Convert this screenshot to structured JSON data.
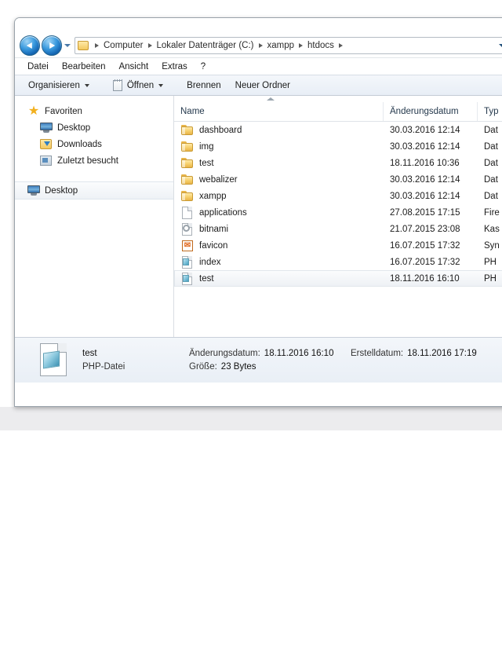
{
  "window": {
    "title": ""
  },
  "address_bar": {
    "back_label": "Zurück",
    "forward_label": "Vorwärts",
    "dropdown_label": "Letzte Seiten",
    "breadcrumbs": [
      "Computer",
      "Lokaler Datenträger (C:)",
      "xampp",
      "htdocs"
    ]
  },
  "menu": {
    "items": [
      "Datei",
      "Bearbeiten",
      "Ansicht",
      "Extras",
      "?"
    ]
  },
  "toolbar": {
    "organize_label": "Organisieren",
    "open_label": "Öffnen",
    "burn_label": "Brennen",
    "new_folder_label": "Neuer Ordner"
  },
  "sidebar": {
    "favorites_label": "Favoriten",
    "favorites": [
      {
        "label": "Desktop",
        "icon": "monitor-icon"
      },
      {
        "label": "Downloads",
        "icon": "downloads-icon"
      },
      {
        "label": "Zuletzt besucht",
        "icon": "recent-icon"
      }
    ],
    "desktop_root": {
      "label": "Desktop",
      "icon": "monitor-icon",
      "selected": true
    }
  },
  "file_list": {
    "columns": [
      "Name",
      "Änderungsdatum",
      "Typ"
    ],
    "sort_column": "Name",
    "sort_direction": "ascending",
    "rows": [
      {
        "name": "dashboard",
        "date": "30.03.2016 12:14",
        "type": "Dat",
        "icon": "folder-icon",
        "selected": false
      },
      {
        "name": "img",
        "date": "30.03.2016 12:14",
        "type": "Dat",
        "icon": "folder-icon",
        "selected": false
      },
      {
        "name": "test",
        "date": "18.11.2016 10:36",
        "type": "Dat",
        "icon": "folder-icon",
        "selected": false
      },
      {
        "name": "webalizer",
        "date": "30.03.2016 12:14",
        "type": "Dat",
        "icon": "folder-icon",
        "selected": false
      },
      {
        "name": "xampp",
        "date": "30.03.2016 12:14",
        "type": "Dat",
        "icon": "folder-icon",
        "selected": false
      },
      {
        "name": "applications",
        "date": "27.08.2015 17:15",
        "type": "Fire",
        "icon": "blank-page-icon",
        "selected": false
      },
      {
        "name": "bitnami",
        "date": "21.07.2015 23:08",
        "type": "Kas",
        "icon": "css-file-icon",
        "selected": false
      },
      {
        "name": "favicon",
        "date": "16.07.2015 17:32",
        "type": "Syn",
        "icon": "favicon-icon",
        "selected": false
      },
      {
        "name": "index",
        "date": "16.07.2015 17:32",
        "type": "PH",
        "icon": "php-file-icon",
        "selected": false
      },
      {
        "name": "test",
        "date": "18.11.2016 16:10",
        "type": "PH",
        "icon": "php-file-icon",
        "selected": true
      }
    ]
  },
  "details_pane": {
    "file_name": "test",
    "file_type": "PHP-Datei",
    "modified_label": "Änderungsdatum:",
    "modified_value": "18.11.2016 16:10",
    "size_label": "Größe:",
    "size_value": "23 Bytes",
    "created_label": "Erstelldatum:",
    "created_value": "18.11.2016 17:19"
  },
  "colors": {
    "accent": "#1567b4",
    "folder": "#f3c960",
    "php_icon": "#4a9fbd",
    "favicon": "#e2661a",
    "toolbar_bg": "#e8eef6",
    "grey_band": "#ececee"
  }
}
